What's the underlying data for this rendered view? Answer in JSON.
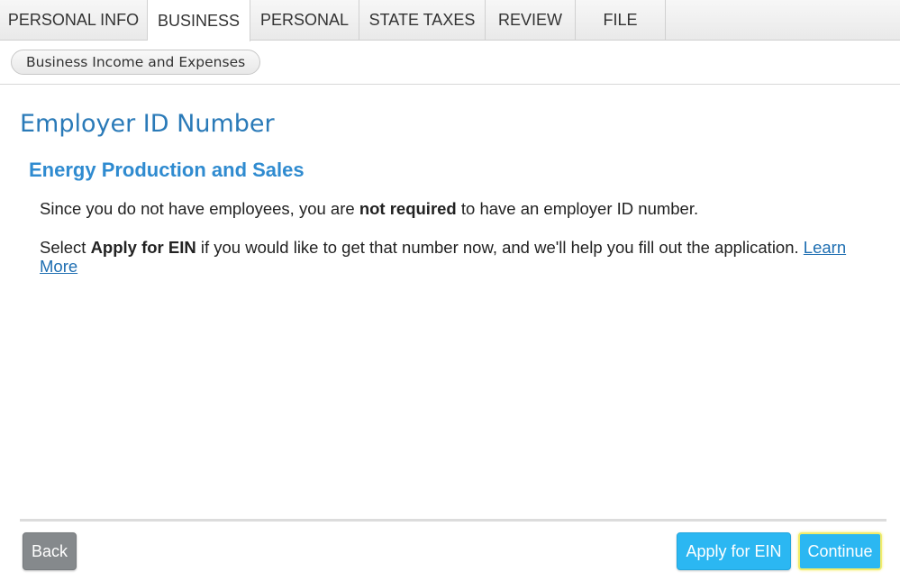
{
  "tabs": [
    {
      "label": "PERSONAL INFO",
      "active": false
    },
    {
      "label": "BUSINESS",
      "active": true
    },
    {
      "label": "PERSONAL",
      "active": false
    },
    {
      "label": "STATE TAXES",
      "active": false
    },
    {
      "label": "REVIEW",
      "active": false
    },
    {
      "label": "FILE",
      "active": false
    }
  ],
  "breadcrumb": {
    "label": "Business Income and Expenses"
  },
  "main": {
    "title": "Employer ID Number",
    "section_title": "Energy Production and Sales",
    "paragraph1": {
      "before": "Since you do not have employees, you are ",
      "bold": "not required",
      "after": " to have an employer ID number."
    },
    "paragraph2": {
      "before": "Select ",
      "bold": "Apply for EIN",
      "after": " if you would like to get that number now, and we'll help you fill out the application. ",
      "link": "Learn More"
    }
  },
  "footer": {
    "back_label": "Back",
    "apply_label": "Apply for EIN",
    "continue_label": "Continue"
  },
  "colors": {
    "title_blue": "#2a7ab8",
    "section_blue": "#2f8bd0",
    "link_blue": "#1f6fb2",
    "primary_button": "#2bb7f2",
    "back_button": "#85898c",
    "focus_highlight": "#f2ec6a"
  }
}
